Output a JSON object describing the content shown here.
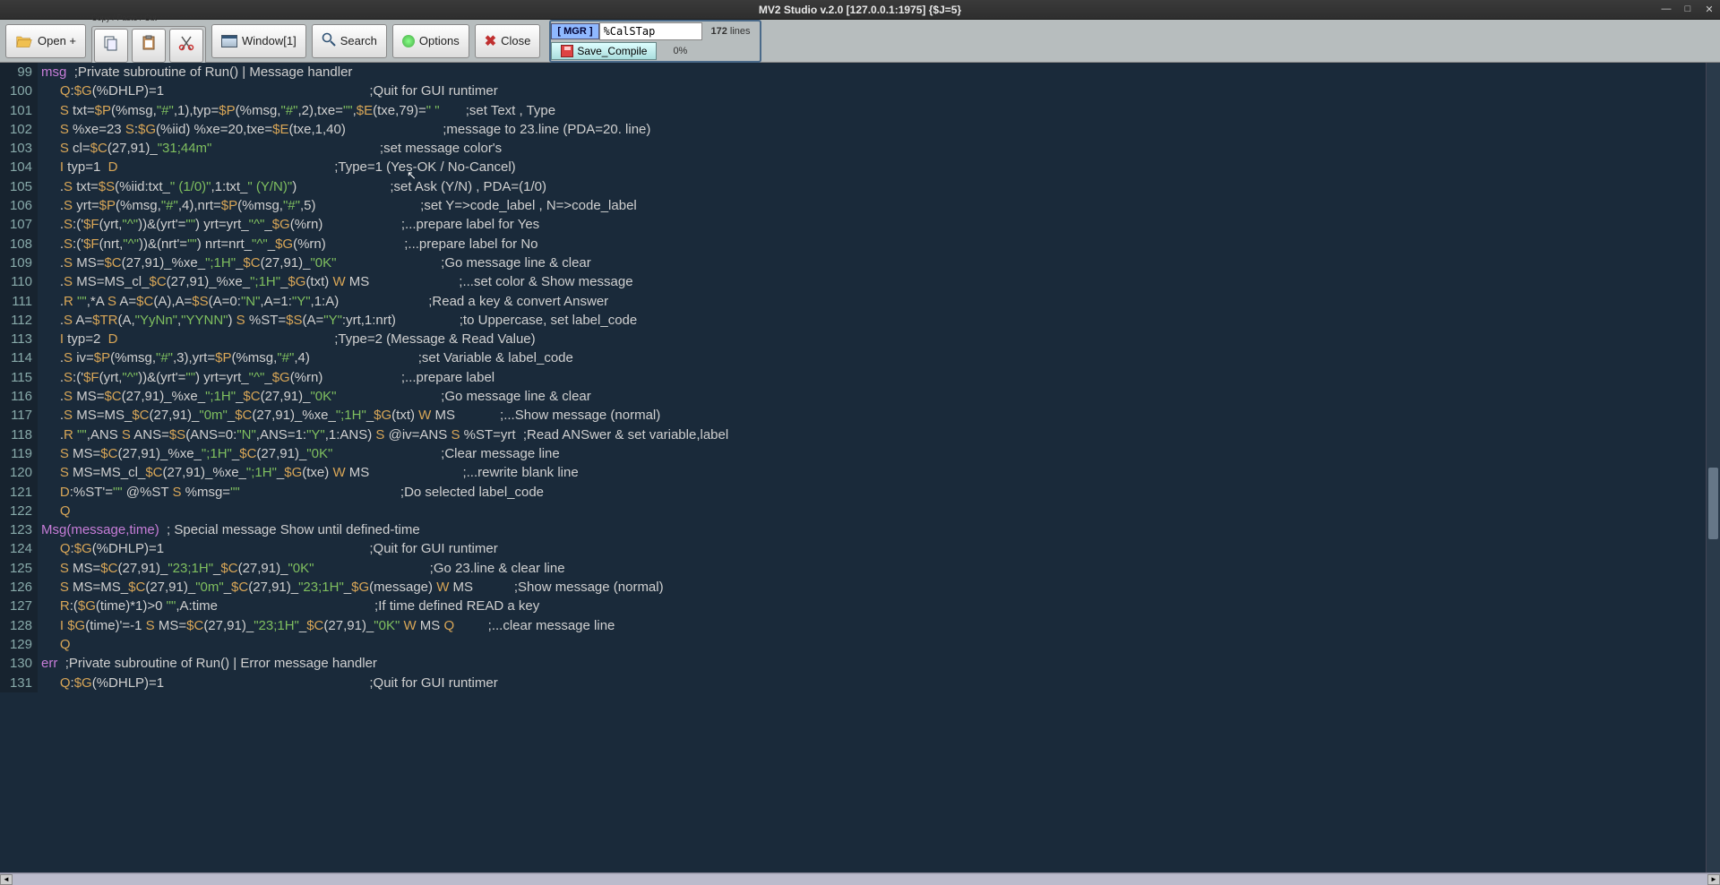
{
  "title": "MV2 Studio v.2.0 [127.0.0.1:1975]  {$J=5}",
  "toolbar": {
    "open": "Open +",
    "cpc_label": "Copy / Paste / Cut",
    "window": "Window[1]",
    "search": "Search",
    "options": "Options",
    "close": "Close"
  },
  "panel": {
    "mgr": "[ MGR    ]",
    "routine": "%CalSTap",
    "lines_count": "172",
    "lines_word": "lines",
    "save": "Save_Compile",
    "pct": "0%"
  },
  "code": [
    {
      "n": "99",
      "label": "msg",
      "body": "  ;Private subroutine of Run() | Message handler"
    },
    {
      "n": "100",
      "body": "     Q:$G(%DHLP)=1                                                       ;Quit for GUI runtimer"
    },
    {
      "n": "101",
      "body": "     S txt=$P(%msg,\"#\",1),typ=$P(%msg,\"#\",2),txe=\"\",$E(txe,79)=\" \"       ;set Text , Type"
    },
    {
      "n": "102",
      "body": "     S %xe=23 S:$G(%iid) %xe=20,txe=$E(txe,1,40)                          ;message to 23.line (PDA=20. line)"
    },
    {
      "n": "103",
      "body": "     S cl=$C(27,91)_\"31;44m\"                                             ;set message color's"
    },
    {
      "n": "104",
      "body": "     I typ=1  D                                                          ;Type=1 (Yes-OK / No-Cancel)"
    },
    {
      "n": "105",
      "body": "     .S txt=$S(%iid:txt_\" (1/0)\",1:txt_\" (Y/N)\")                         ;set Ask (Y/N) , PDA=(1/0)"
    },
    {
      "n": "106",
      "body": "     .S yrt=$P(%msg,\"#\",4),nrt=$P(%msg,\"#\",5)                            ;set Y=>code_label , N=>code_label"
    },
    {
      "n": "107",
      "body": "     .S:('$F(yrt,\"^\"))&(yrt'=\"\") yrt=yrt_\"^\"_$G(%rn)                     ;...prepare label for Yes"
    },
    {
      "n": "108",
      "body": "     .S:('$F(nrt,\"^\"))&(nrt'=\"\") nrt=nrt_\"^\"_$G(%rn)                     ;...prepare label for No"
    },
    {
      "n": "109",
      "body": "     .S MS=$C(27,91)_%xe_\";1H\"_$C(27,91)_\"0K\"                            ;Go message line & clear"
    },
    {
      "n": "110",
      "body": "     .S MS=MS_cl_$C(27,91)_%xe_\";1H\"_$G(txt) W MS                        ;...set color & Show message"
    },
    {
      "n": "111",
      "body": "     .R \"\",*A S A=$C(A),A=$S(A=0:\"N\",A=1:\"Y\",1:A)                        ;Read a key & convert Answer"
    },
    {
      "n": "112",
      "body": "     .S A=$TR(A,\"YyNn\",\"YYNN\") S %ST=$S(A=\"Y\":yrt,1:nrt)                 ;to Uppercase, set label_code"
    },
    {
      "n": "113",
      "body": "     I typ=2  D                                                          ;Type=2 (Message & Read Value)"
    },
    {
      "n": "114",
      "body": "     .S iv=$P(%msg,\"#\",3),yrt=$P(%msg,\"#\",4)                             ;set Variable & label_code"
    },
    {
      "n": "115",
      "body": "     .S:('$F(yrt,\"^\"))&(yrt'=\"\") yrt=yrt_\"^\"_$G(%rn)                     ;...prepare label"
    },
    {
      "n": "116",
      "body": "     .S MS=$C(27,91)_%xe_\";1H\"_$C(27,91)_\"0K\"                            ;Go message line & clear"
    },
    {
      "n": "117",
      "body": "     .S MS=MS_$C(27,91)_\"0m\"_$C(27,91)_%xe_\";1H\"_$G(txt) W MS            ;...Show message (normal)"
    },
    {
      "n": "118",
      "body": "     .R \"\",ANS S ANS=$S(ANS=0:\"N\",ANS=1:\"Y\",1:ANS) S @iv=ANS S %ST=yrt  ;Read ANSwer & set variable,label"
    },
    {
      "n": "119",
      "body": "     S MS=$C(27,91)_%xe_\";1H\"_$C(27,91)_\"0K\"                             ;Clear message line"
    },
    {
      "n": "120",
      "body": "     S MS=MS_cl_$C(27,91)_%xe_\";1H\"_$G(txe) W MS                         ;...rewrite blank line"
    },
    {
      "n": "121",
      "body": "     D:%ST'=\"\" @%ST S %msg=\"\"                                           ;Do selected label_code"
    },
    {
      "n": "122",
      "body": "     Q"
    },
    {
      "n": "123",
      "label": "Msg",
      "arg": "(message,time)",
      "body": "  ; Special message Show until defined-time"
    },
    {
      "n": "124",
      "body": "     Q:$G(%DHLP)=1                                                       ;Quit for GUI runtimer"
    },
    {
      "n": "125",
      "body": "     S MS=$C(27,91)_\"23;1H\"_$C(27,91)_\"0K\"                               ;Go 23.line & clear line"
    },
    {
      "n": "126",
      "body": "     S MS=MS_$C(27,91)_\"0m\"_$C(27,91)_\"23;1H\"_$G(message) W MS           ;Show message (normal)"
    },
    {
      "n": "127",
      "body": "     R:($G(time)*1)>0 \"\",A:time                                          ;If time defined READ a key"
    },
    {
      "n": "128",
      "body": "     I $G(time)'=-1 S MS=$C(27,91)_\"23;1H\"_$C(27,91)_\"0K\" W MS Q         ;...clear message line"
    },
    {
      "n": "129",
      "body": "     Q"
    },
    {
      "n": "130",
      "label": "err",
      "body": "  ;Private subroutine of Run() | Error message handler"
    },
    {
      "n": "131",
      "body": "     Q:$G(%DHLP)=1                                                       ;Quit for GUI runtimer"
    }
  ]
}
